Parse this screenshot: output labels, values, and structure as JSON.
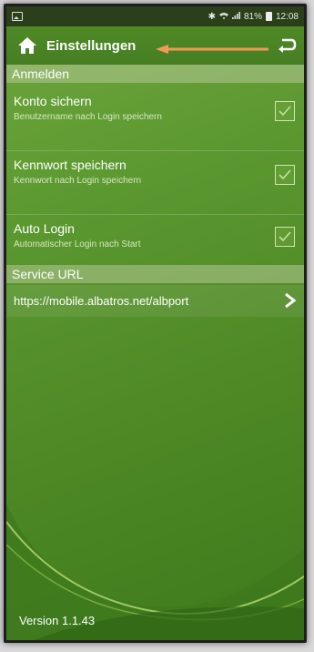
{
  "status_bar": {
    "battery_percent": "81%",
    "time": "12:08",
    "signal_icons": [
      "bluetooth-icon",
      "wifi-icon",
      "cell-signal-icon"
    ]
  },
  "toolbar": {
    "title": "Einstellungen",
    "home_icon": "home-icon",
    "back_icon": "back-icon",
    "arrow_color": "#f29a59"
  },
  "sections": {
    "anmelden": {
      "header": "Anmelden",
      "items": [
        {
          "label": "Konto sichern",
          "sub": "Benutzername nach Login speichern",
          "checked": true
        },
        {
          "label": "Kennwort speichern",
          "sub": "Kennwort nach Login speichern",
          "checked": true
        },
        {
          "label": "Auto Login",
          "sub": "Automatischer Login nach Start",
          "checked": true
        }
      ]
    },
    "service": {
      "header": "Service URL",
      "url": "https://mobile.albatros.net/albport"
    }
  },
  "footer": {
    "version": "Version  1.1.43"
  },
  "colors": {
    "accent_green": "#5c9830",
    "checkbox_border": "#cfe5b0",
    "check_color": "#bfe69a"
  }
}
